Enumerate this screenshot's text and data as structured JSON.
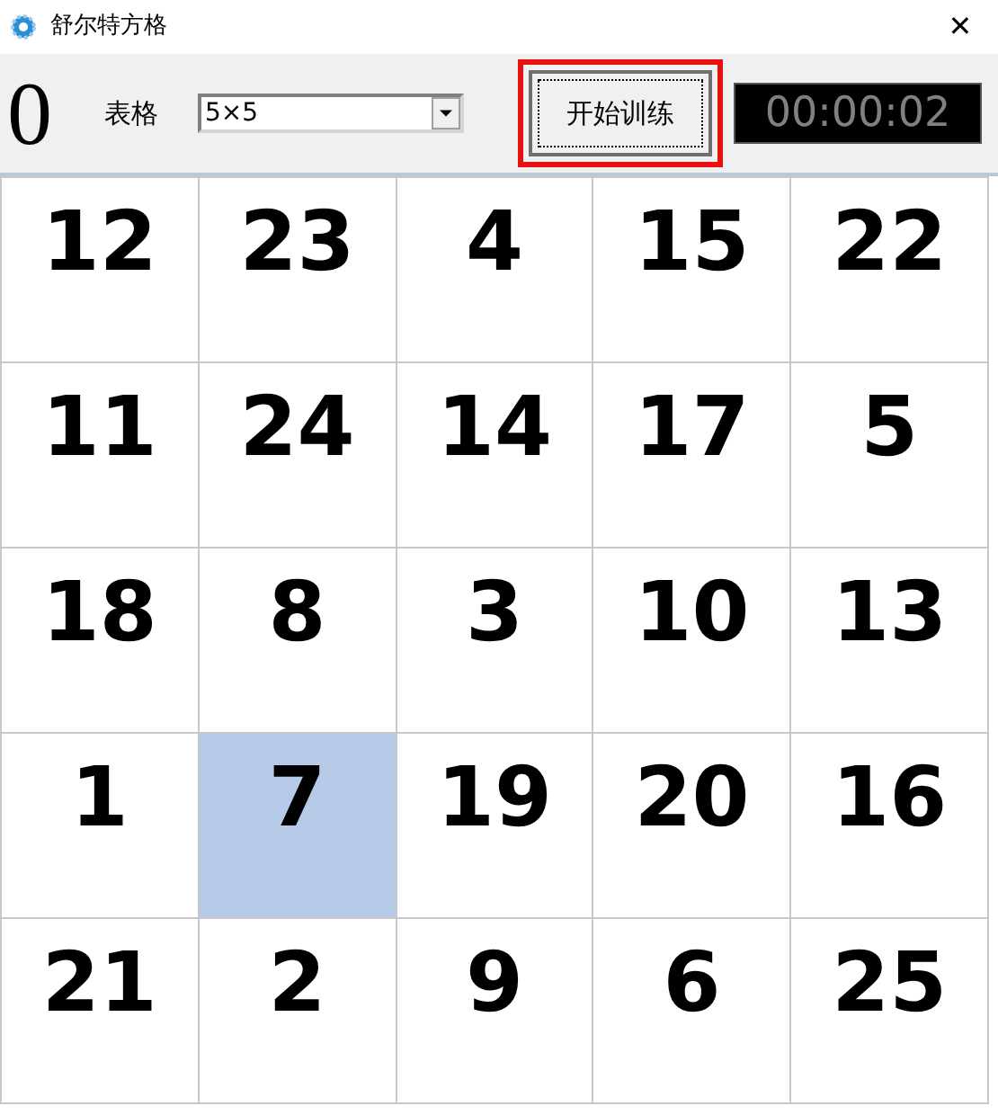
{
  "window": {
    "title": "舒尔特方格",
    "close": "✕"
  },
  "toolbar": {
    "score": "0",
    "table_label": "表格",
    "table_size": "5×5",
    "start_button": {
      "label": "开始训练",
      "outlined": true
    },
    "timer": "00:00:02"
  },
  "grid": {
    "cells": [
      {
        "number": "12",
        "selected": false
      },
      {
        "number": "23",
        "selected": false
      },
      {
        "number": "4",
        "selected": false
      },
      {
        "number": "15",
        "selected": false
      },
      {
        "number": "22",
        "selected": false
      },
      {
        "number": "11",
        "selected": false
      },
      {
        "number": "24",
        "selected": false
      },
      {
        "number": "14",
        "selected": false
      },
      {
        "number": "17",
        "selected": false
      },
      {
        "number": "5",
        "selected": false
      },
      {
        "number": "18",
        "selected": false
      },
      {
        "number": "8",
        "selected": false
      },
      {
        "number": "3",
        "selected": false
      },
      {
        "number": "10",
        "selected": false
      },
      {
        "number": "13",
        "selected": false
      },
      {
        "number": "1",
        "selected": false
      },
      {
        "number": "7",
        "selected": true
      },
      {
        "number": "19",
        "selected": false
      },
      {
        "number": "20",
        "selected": false
      },
      {
        "number": "16",
        "selected": false
      },
      {
        "number": "21",
        "selected": false
      },
      {
        "number": "2",
        "selected": false
      },
      {
        "number": "9",
        "selected": false
      },
      {
        "number": "6",
        "selected": false
      },
      {
        "number": "25",
        "selected": false
      }
    ]
  }
}
